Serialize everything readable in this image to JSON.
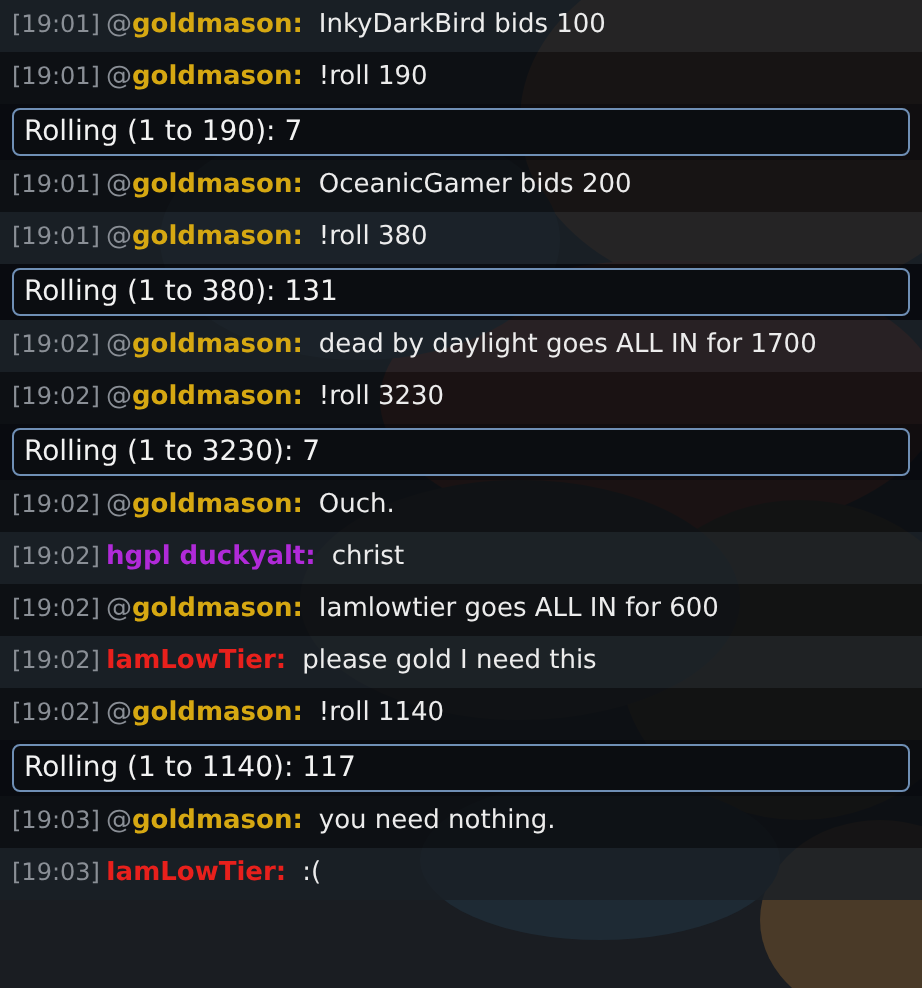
{
  "messages": [
    {
      "kind": "chat",
      "time": "[19:01]",
      "prefix": "@",
      "user": "goldmason:",
      "color": "#d6a812",
      "text": "InkyDarkBird bids 100"
    },
    {
      "kind": "chat",
      "time": "[19:01]",
      "prefix": "@",
      "user": "goldmason:",
      "color": "#d6a812",
      "text": "!roll 190"
    },
    {
      "kind": "roll",
      "text": "Rolling (1 to 190): 7"
    },
    {
      "kind": "chat",
      "time": "[19:01]",
      "prefix": "@",
      "user": "goldmason:",
      "color": "#d6a812",
      "text": "OceanicGamer bids 200"
    },
    {
      "kind": "chat",
      "time": "[19:01]",
      "prefix": "@",
      "user": "goldmason:",
      "color": "#d6a812",
      "text": "!roll 380"
    },
    {
      "kind": "roll",
      "text": "Rolling (1 to 380): 131"
    },
    {
      "kind": "chat",
      "time": "[19:02]",
      "prefix": "@",
      "user": "goldmason:",
      "color": "#d6a812",
      "text": "dead by daylight goes ALL IN for 1700"
    },
    {
      "kind": "chat",
      "time": "[19:02]",
      "prefix": "@",
      "user": "goldmason:",
      "color": "#d6a812",
      "text": "!roll 3230"
    },
    {
      "kind": "roll",
      "text": "Rolling (1 to 3230): 7"
    },
    {
      "kind": "chat",
      "time": "[19:02]",
      "prefix": "@",
      "user": "goldmason:",
      "color": "#d6a812",
      "text": "Ouch."
    },
    {
      "kind": "chat",
      "time": "[19:02]",
      "user": "hgpl duckyalt:",
      "color": "#b02ad8",
      "text": "christ"
    },
    {
      "kind": "chat",
      "time": "[19:02]",
      "prefix": "@",
      "user": "goldmason:",
      "color": "#d6a812",
      "text": "Iamlowtier goes ALL IN for 600"
    },
    {
      "kind": "chat",
      "time": "[19:02]",
      "user": "IamLowTier:",
      "color": "#e8201c",
      "text": "please gold I need this"
    },
    {
      "kind": "chat",
      "time": "[19:02]",
      "prefix": "@",
      "user": "goldmason:",
      "color": "#d6a812",
      "text": "!roll 1140"
    },
    {
      "kind": "roll",
      "text": "Rolling (1 to 1140): 117"
    },
    {
      "kind": "chat",
      "time": "[19:03]",
      "prefix": "@",
      "user": "goldmason:",
      "color": "#d6a812",
      "text": "you need nothing."
    },
    {
      "kind": "chat",
      "time": "[19:03]",
      "user": "IamLowTier:",
      "color": "#e8201c",
      "text": ":("
    }
  ]
}
